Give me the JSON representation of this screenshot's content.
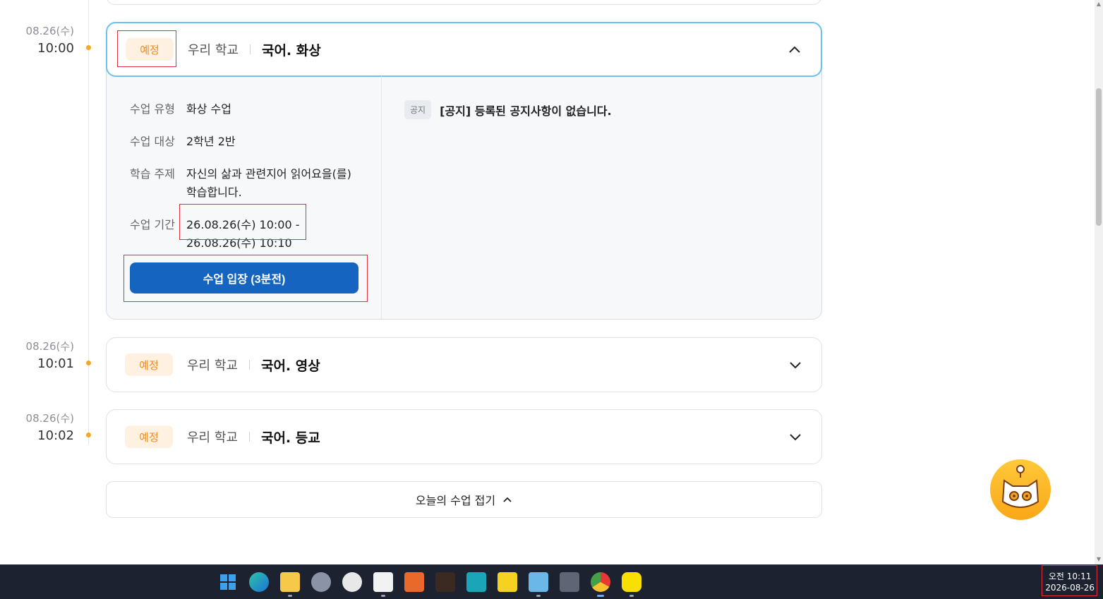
{
  "timeline": [
    {
      "date": "08.26(수)",
      "time": "10:00"
    },
    {
      "date": "08.26(수)",
      "time": "10:01"
    },
    {
      "date": "08.26(수)",
      "time": "10:02"
    }
  ],
  "classes": [
    {
      "status": "예정",
      "school": "우리 학교",
      "subject": "국어. 화상",
      "details": {
        "type_label": "수업 유형",
        "type_value": "화상 수업",
        "target_label": "수업 대상",
        "target_value": "2학년 2반",
        "topic_label": "학습 주제",
        "topic_value": "자신의 삶과 관련지어 읽어요을(를) 학습합니다.",
        "period_label": "수업 기간",
        "period_start": "26.08.26(수) 10:00 -",
        "period_end": "26.08.26(수) 10:10"
      },
      "enter_button": "수업 입장 (3분전)",
      "notice_tag": "공지",
      "notice_text": "[공지] 등록된 공지사항이 없습니다."
    },
    {
      "status": "예정",
      "school": "우리 학교",
      "subject": "국어. 영상"
    },
    {
      "status": "예정",
      "school": "우리 학교",
      "subject": "국어. 등교"
    }
  ],
  "collapse_label": "오늘의 수업 접기",
  "taskbar": {
    "icons": [
      "windows-start-icon",
      "edge-icon",
      "file-explorer-icon",
      "settings-icon",
      "clock-icon",
      "snipping-tool-icon",
      "touch-app-icon",
      "pen-app-icon",
      "bolt-app-icon",
      "sticky-notes-icon",
      "notepad-icon",
      "calculator-icon",
      "chrome-icon",
      "kakaotalk-icon"
    ],
    "clock_ampm_time": "오전 10:11",
    "clock_date": "2026-08-26"
  },
  "colors": {
    "accent_blue": "#1565c0",
    "badge_orange": "#f08a1c",
    "timeline_dot": "#f5a623",
    "highlight_red": "#e0303c"
  }
}
